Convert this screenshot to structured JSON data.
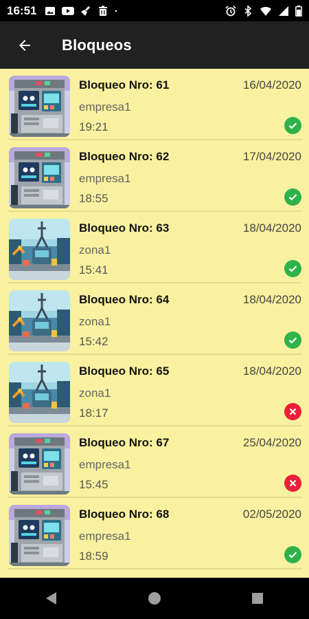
{
  "status_bar": {
    "time": "16:51",
    "left_icons": [
      "image-icon",
      "youtube-icon",
      "broom-icon",
      "trash-icon",
      "dot-icon"
    ],
    "right_icons": [
      "alarm-icon",
      "bluetooth-icon",
      "wifi-icon",
      "signal-icon",
      "battery-icon"
    ]
  },
  "app_bar": {
    "title": "Bloqueos"
  },
  "items": [
    {
      "title": "Bloqueo Nro: 61",
      "date": "16/04/2020",
      "subtitle": "empresa1",
      "time": "19:21",
      "status": "ok",
      "image": "machine"
    },
    {
      "title": "Bloqueo Nro: 62",
      "date": "17/04/2020",
      "subtitle": "empresa1",
      "time": "18:55",
      "status": "ok",
      "image": "machine"
    },
    {
      "title": "Bloqueo Nro: 63",
      "date": "18/04/2020",
      "subtitle": "zona1",
      "time": "15:41",
      "status": "ok",
      "image": "factory"
    },
    {
      "title": "Bloqueo Nro: 64",
      "date": "18/04/2020",
      "subtitle": "zona1",
      "time": "15:42",
      "status": "ok",
      "image": "factory"
    },
    {
      "title": "Bloqueo Nro: 65",
      "date": "18/04/2020",
      "subtitle": "zona1",
      "time": "18:17",
      "status": "error",
      "image": "factory"
    },
    {
      "title": "Bloqueo Nro: 67",
      "date": "25/04/2020",
      "subtitle": "empresa1",
      "time": "15:45",
      "status": "error",
      "image": "machine"
    },
    {
      "title": "Bloqueo Nro: 68",
      "date": "02/05/2020",
      "subtitle": "empresa1",
      "time": "18:59",
      "status": "ok",
      "image": "machine"
    }
  ],
  "colors": {
    "list_bg": "#f9f19f",
    "app_bar": "#212121",
    "ok": "#2fb24b",
    "error": "#e8203a"
  }
}
